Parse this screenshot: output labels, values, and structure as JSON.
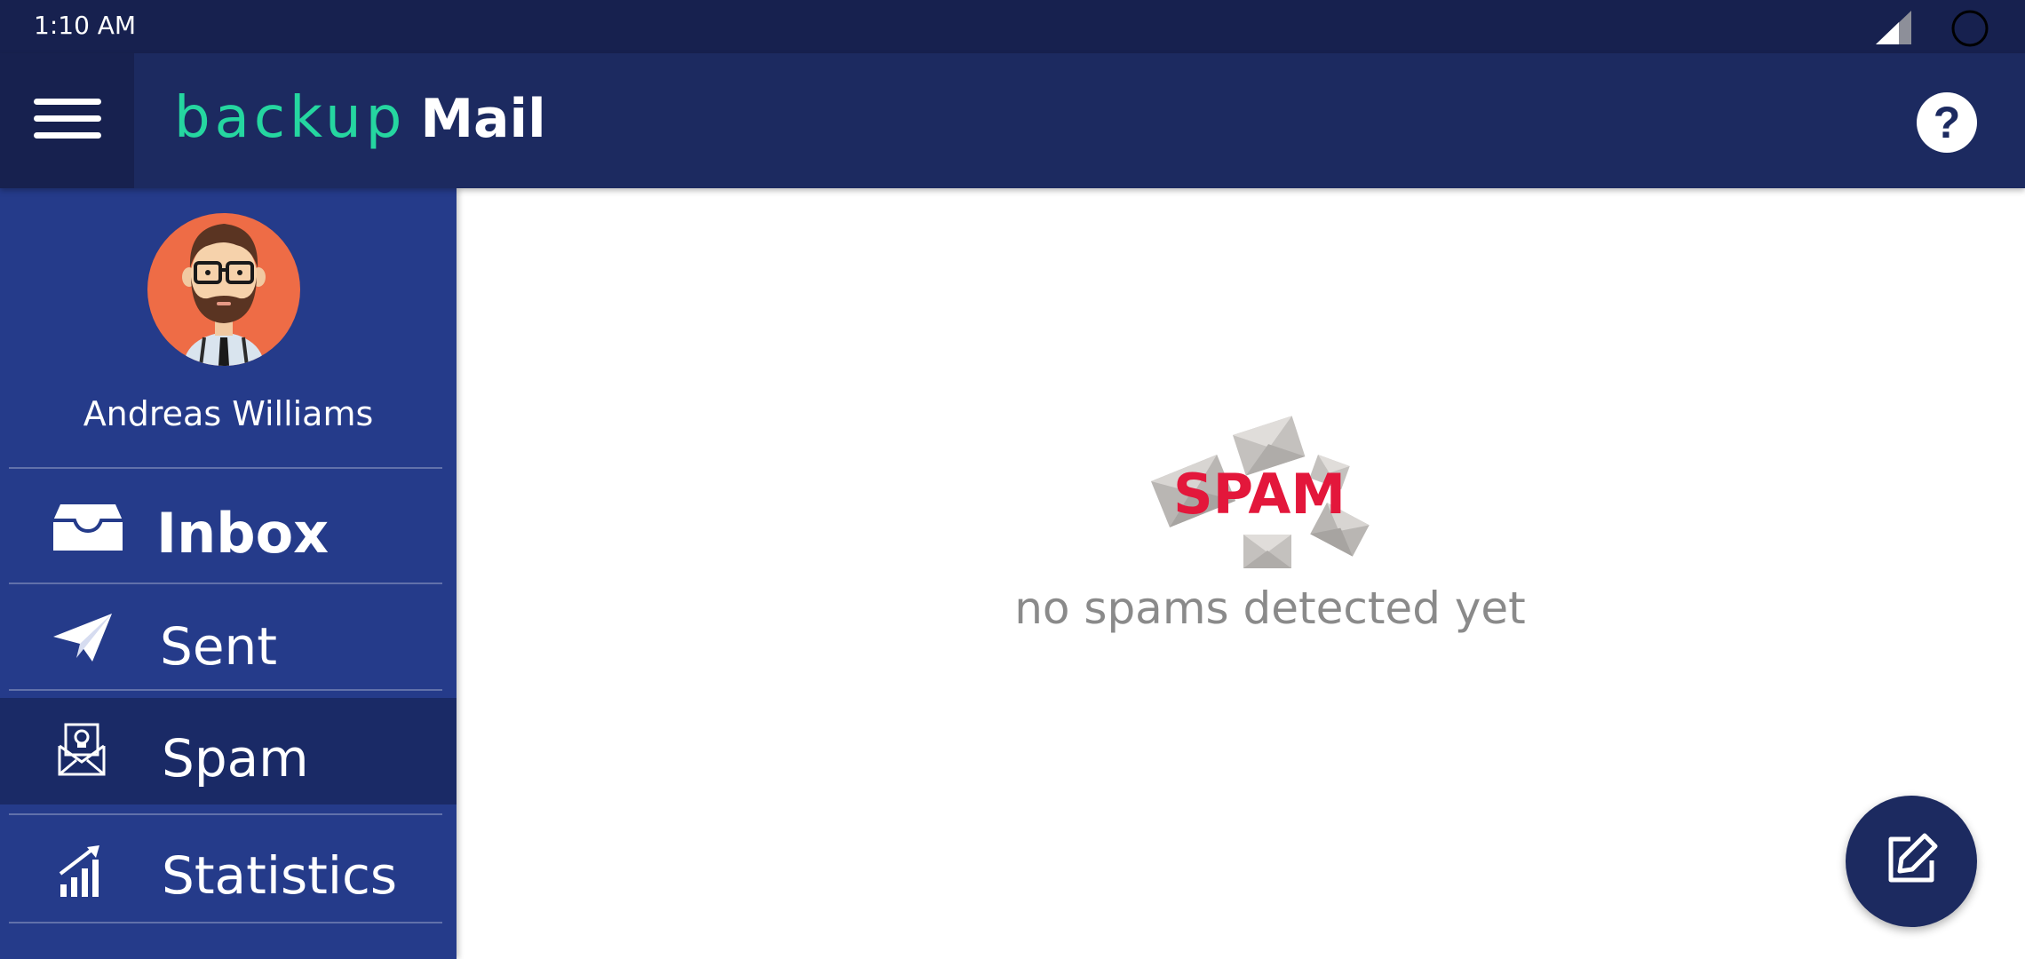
{
  "status_bar": {
    "time": "1:10 AM",
    "icons": [
      "signal-icon",
      "loading-circle-icon"
    ]
  },
  "app_bar": {
    "menu_icon": "hamburger-menu-icon",
    "logo": {
      "part1": "backup",
      "part2": "Mail"
    },
    "help_label": "?"
  },
  "sidebar": {
    "user_name": "Andreas Williams",
    "items": [
      {
        "label": "Inbox",
        "icon": "inbox-tray-icon",
        "active": false
      },
      {
        "label": "Sent",
        "icon": "paper-plane-icon",
        "active": false
      },
      {
        "label": "Spam",
        "icon": "spam-envelope-icon",
        "active": true
      },
      {
        "label": "Statistics",
        "icon": "bar-chart-icon",
        "active": false
      }
    ]
  },
  "main": {
    "spam_badge": "SPAM",
    "empty_message": "no spams detected yet"
  },
  "fab": {
    "icon": "compose-edit-icon"
  },
  "colors": {
    "status_bar": "#17214f",
    "app_bar": "#1c2a60",
    "sidebar": "#253b8a",
    "sidebar_active": "#1a2a66",
    "logo_accent": "#25d6a0",
    "avatar_bg": "#ee6c46",
    "spam_red": "#e3173b"
  }
}
